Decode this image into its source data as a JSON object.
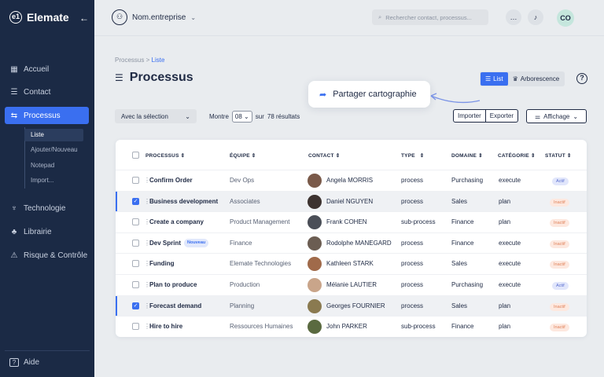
{
  "app": {
    "name": "Elemate",
    "logo_mark": "e1"
  },
  "sidebar": {
    "items": [
      {
        "label": "Accueil",
        "icon": "grid-icon"
      },
      {
        "label": "Contact",
        "icon": "contact-icon"
      },
      {
        "label": "Processus",
        "icon": "process-icon",
        "active": true
      },
      {
        "label": "Technologie",
        "icon": "tech-icon"
      },
      {
        "label": "Librairie",
        "icon": "library-icon"
      },
      {
        "label": "Risque & Contrôle",
        "icon": "warning-icon"
      }
    ],
    "subitems": [
      {
        "label": "Liste",
        "active": true
      },
      {
        "label": "Ajouter/Nouveau"
      },
      {
        "label": "Notepad"
      },
      {
        "label": "Import..."
      }
    ],
    "help_label": "Aide"
  },
  "topbar": {
    "org_name": "Nom.entreprise",
    "search_placeholder": "Rechercher contact, processus...",
    "avatar_initials": "CO"
  },
  "breadcrumb": {
    "parent": "Processus",
    "separator": ">",
    "current": "Liste"
  },
  "page": {
    "title": "Processus"
  },
  "view_toggle": {
    "list_label": "List",
    "tree_label": "Arborescence",
    "active": "List"
  },
  "tooltip": {
    "label": "Partager cartographie"
  },
  "toolbar": {
    "selection_label": "Avec la sélection",
    "show_label": "Montre",
    "page_size": "08",
    "results_prefix": "sur",
    "results_label": "78 résultats",
    "import_label": "Importer",
    "export_label": "Exporter",
    "display_label": "Affichage"
  },
  "table": {
    "headers": {
      "processus": "PROCESSUS",
      "equipe": "ÉQUIPE",
      "contact": "CONTACT",
      "type": "TYPE",
      "domaine": "DOMAINE",
      "categorie": "CATÉGORIE",
      "statut": "STATUT"
    },
    "rows": [
      {
        "processus": "Confirm Order",
        "badge": "",
        "equipe": "Dev Ops",
        "contact": "Angela MORRIS",
        "type": "process",
        "domaine": "Purchasing",
        "categorie": "execute",
        "statut": "Actif",
        "selected": false,
        "avatar_color": "#7a5a4a"
      },
      {
        "processus": "Business development",
        "badge": "",
        "equipe": "Associates",
        "contact": "Daniel NGUYEN",
        "type": "process",
        "domaine": "Sales",
        "categorie": "plan",
        "statut": "Inactif",
        "selected": true,
        "avatar_color": "#3d3330"
      },
      {
        "processus": "Create a company",
        "badge": "",
        "equipe": "Product Management",
        "contact": "Frank COHEN",
        "type": "sub-process",
        "domaine": "Finance",
        "categorie": "plan",
        "statut": "Inactif",
        "selected": false,
        "avatar_color": "#4a4e57"
      },
      {
        "processus": "Dev Sprint",
        "badge": "Nouveau",
        "equipe": "Finance",
        "contact": "Rodolphe MANEGARD",
        "type": "process",
        "domaine": "Finance",
        "categorie": "execute",
        "statut": "Inactif",
        "selected": false,
        "avatar_color": "#6b5d52"
      },
      {
        "processus": "Funding",
        "badge": "",
        "equipe": "Elemate Technologies",
        "contact": "Kathleen STARK",
        "type": "process",
        "domaine": "Sales",
        "categorie": "execute",
        "statut": "Inactif",
        "selected": false,
        "avatar_color": "#a06a4a"
      },
      {
        "processus": "Plan to produce",
        "badge": "",
        "equipe": "Production",
        "contact": "Mélanie LAUTIER",
        "type": "process",
        "domaine": "Purchasing",
        "categorie": "execute",
        "statut": "Actif",
        "selected": false,
        "avatar_color": "#c9a58a"
      },
      {
        "processus": "Forecast demand",
        "badge": "",
        "equipe": "Planning",
        "contact": "Georges FOURNIER",
        "type": "process",
        "domaine": "Sales",
        "categorie": "plan",
        "statut": "Inactif",
        "selected": true,
        "avatar_color": "#8a7a50"
      },
      {
        "processus": "Hire to hire",
        "badge": "",
        "equipe": "Ressources Humaines",
        "contact": "John PARKER",
        "type": "sub-process",
        "domaine": "Finance",
        "categorie": "plan",
        "statut": "Inactif",
        "selected": false,
        "avatar_color": "#5a6a40"
      }
    ]
  },
  "colors": {
    "sidebar": "#1b2a45",
    "accent": "#3a6ff0",
    "active_status": "#5a6fd0",
    "inactive_status": "#e0825a"
  }
}
